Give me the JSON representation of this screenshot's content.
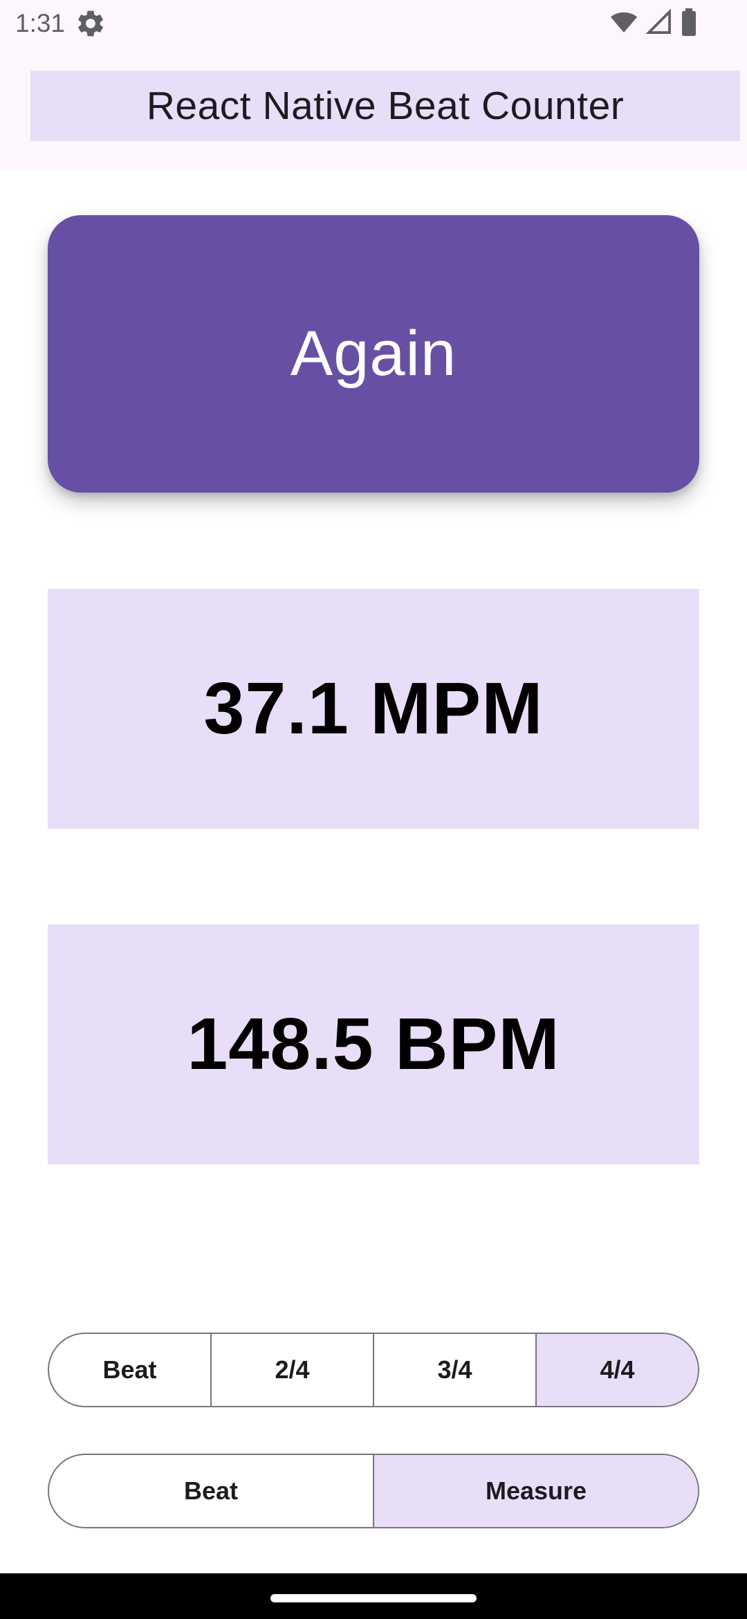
{
  "status_bar": {
    "time": "1:31",
    "icons": [
      "settings-gear-icon",
      "wifi-icon",
      "cellular-signal-icon",
      "battery-icon"
    ]
  },
  "header": {
    "title": "React Native Beat Counter"
  },
  "again_button": {
    "label": "Again"
  },
  "readouts": {
    "mpm": "37.1 MPM",
    "bpm": "148.5 BPM"
  },
  "time_signature": {
    "options": [
      "Beat",
      "2/4",
      "3/4",
      "4/4"
    ],
    "selected": "4/4"
  },
  "mode": {
    "options": [
      "Beat",
      "Measure"
    ],
    "selected": "Measure"
  },
  "colors": {
    "primary": "#6750a4",
    "surface_container": "#e8def8",
    "outline": "#79747e",
    "background": "#fdf7fd"
  }
}
